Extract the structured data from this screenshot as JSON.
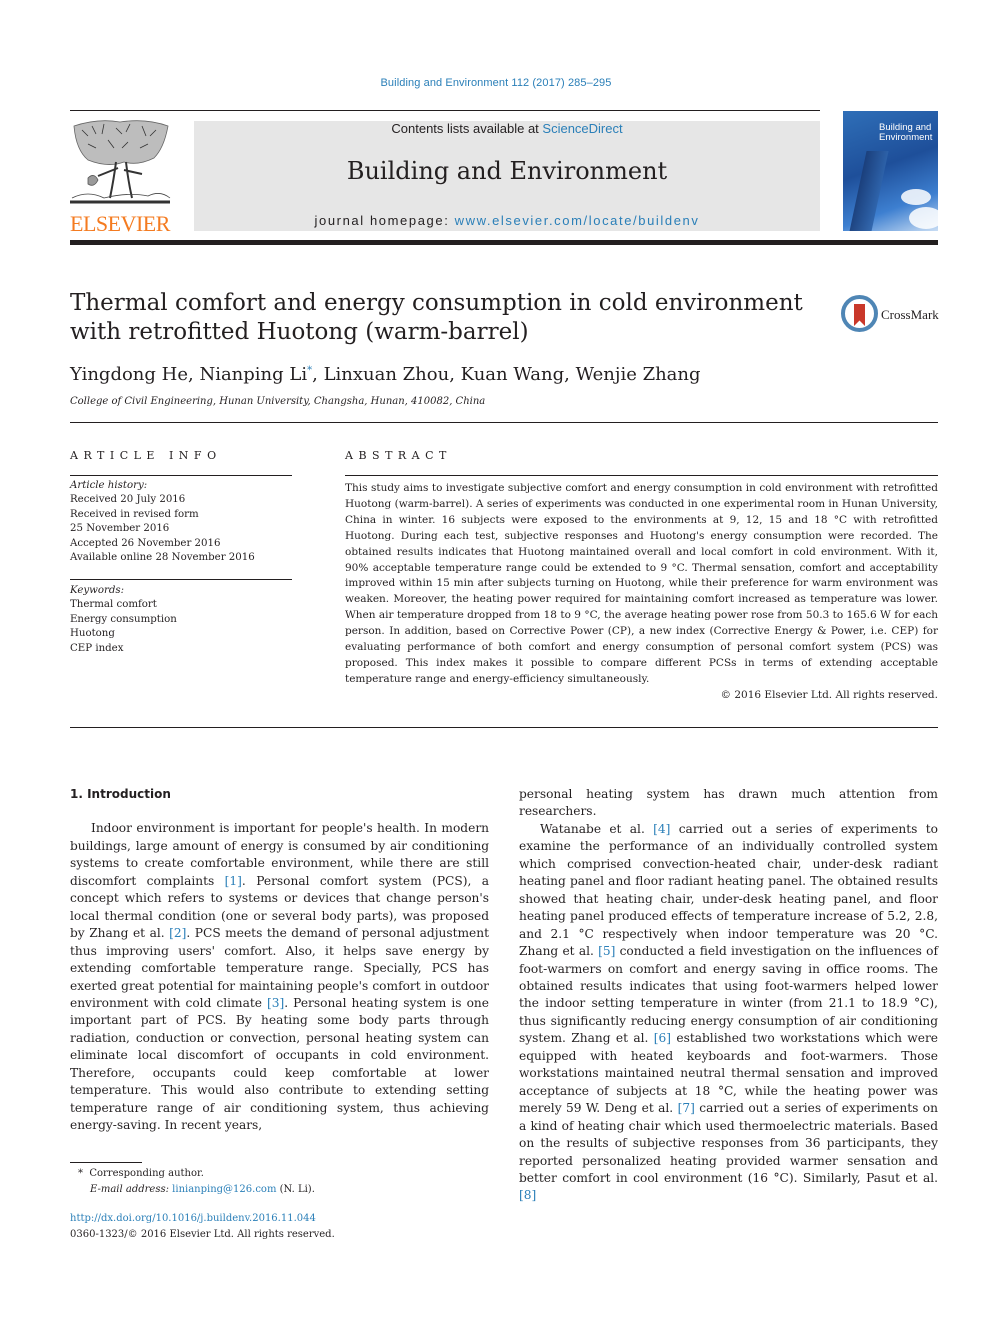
{
  "header": {
    "journal_ref": "Building and Environment 112 (2017) 285–295",
    "contents_prefix": "Contents lists available at ",
    "contents_link": "ScienceDirect",
    "journal_name": "Building and Environment",
    "homepage_prefix": "journal homepage: ",
    "homepage_link": "www.elsevier.com/locate/buildenv",
    "publisher_logo_text": "ELSEVIER",
    "cover_title_line1": "Building and",
    "cover_title_line2": "Environment",
    "brand_color": "#f47b20",
    "link_color": "#2a7fb8"
  },
  "article": {
    "title": "Thermal comfort and energy consumption in cold environment with retrofitted Huotong (warm-barrel)",
    "crossmark_label": "CrossMark",
    "authors": [
      {
        "name": "Yingdong He",
        "sep": ", "
      },
      {
        "name": "Nianping Li",
        "mark": "*",
        "sep": ", "
      },
      {
        "name": "Linxuan Zhou",
        "sep": ", "
      },
      {
        "name": "Kuan Wang",
        "sep": ", "
      },
      {
        "name": "Wenjie Zhang",
        "sep": ""
      }
    ],
    "affiliation": "College of Civil Engineering, Hunan University, Changsha, Hunan, 410082, China"
  },
  "article_info": {
    "heading": "ARTICLE INFO",
    "history_label": "Article history:",
    "history": [
      "Received 20 July 2016",
      "Received in revised form",
      "25 November 2016",
      "Accepted 26 November 2016",
      "Available online 28 November 2016"
    ],
    "keywords_label": "Keywords:",
    "keywords": [
      "Thermal comfort",
      "Energy consumption",
      "Huotong",
      "CEP index"
    ]
  },
  "abstract": {
    "heading": "ABSTRACT",
    "text": "This study aims to investigate subjective comfort and energy consumption in cold environment with retrofitted Huotong (warm-barrel). A series of experiments was conducted in one experimental room in Hunan University, China in winter. 16 subjects were exposed to the environments at 9, 12, 15 and 18 °C with retrofitted Huotong. During each test, subjective responses and Huotong's energy consumption were recorded. The obtained results indicates that Huotong maintained overall and local comfort in cold environment. With it, 90% acceptable temperature range could be extended to 9 °C. Thermal sensation, comfort and acceptability improved within 15 min after subjects turning on Huotong, while their preference for warm environment was weaken. Moreover, the heating power required for maintaining comfort increased as temperature was lower. When air temperature dropped from 18 to 9 °C, the average heating power rose from 50.3 to 165.6 W for each person. In addition, based on Corrective Power (CP), a new index (Corrective Energy & Power, i.e. CEP) for evaluating performance of both comfort and energy consumption of personal comfort system (PCS) was proposed. This index makes it possible to compare different PCSs in terms of extending acceptable temperature range and energy-efficiency simultaneously.",
    "copyright": "© 2016 Elsevier Ltd. All rights reserved."
  },
  "body": {
    "section_heading": "1.  Introduction",
    "left_segments": [
      {
        "t": "Indoor environment is important for people's health. In modern buildings, large amount of energy is consumed by air conditioning systems to create comfortable environment, while there are still discomfort complaints "
      },
      {
        "cite": "[1]"
      },
      {
        "t": ". Personal comfort system (PCS), a concept which refers to systems or devices that change person's local thermal condition (one or several body parts), was proposed by Zhang et al. "
      },
      {
        "cite": "[2]"
      },
      {
        "t": ". PCS meets the demand of personal adjustment thus improving users' comfort. Also, it helps save energy by extending comfortable temperature range. Specially, PCS has exerted great potential for maintaining people's comfort in outdoor environment with cold climate "
      },
      {
        "cite": "[3]"
      },
      {
        "t": ". Personal heating system is one important part of PCS. By heating some body parts through radiation, conduction or convection, personal heating system can eliminate local discomfort of occupants in cold environment. Therefore, occupants could keep comfortable at lower temperature. This would also contribute to extending setting temperature range of air conditioning system, thus achieving energy-saving. In recent years,"
      }
    ],
    "right_first": "personal heating system has drawn much attention from researchers.",
    "right_segments": [
      {
        "t": "Watanabe et al. "
      },
      {
        "cite": "[4]"
      },
      {
        "t": " carried out a series of experiments to examine the performance of an individually controlled system which comprised convection-heated chair, under-desk radiant heating panel and floor radiant heating panel. The obtained results showed that heating chair, under-desk heating panel, and floor heating panel produced effects of temperature increase of 5.2, 2.8, and 2.1 °C respectively when indoor temperature was 20 °C. Zhang et al. "
      },
      {
        "cite": "[5]"
      },
      {
        "t": " conducted a field investigation on the influences of foot-warmers on comfort and energy saving in office rooms. The obtained results indicates that using foot-warmers helped lower the indoor setting temperature in winter (from 21.1 to 18.9 °C), thus significantly reducing energy consumption of air conditioning system. Zhang et al. "
      },
      {
        "cite": "[6]"
      },
      {
        "t": " established two workstations which were equipped with heated keyboards and foot-warmers. Those workstations maintained neutral thermal sensation and improved acceptance of subjects at 18 °C, while the heating power was merely 59 W. Deng et al. "
      },
      {
        "cite": "[7]"
      },
      {
        "t": " carried out a series of experiments on a kind of heating chair which used thermoelectric materials. Based on the results of subjective responses from 36 participants, they reported personalized heating provided warmer sensation and better comfort in cool environment (16 °C). Similarly, Pasut et al. "
      },
      {
        "cite": "[8]"
      }
    ]
  },
  "footnotes": {
    "mark": "*",
    "corresponding": "Corresponding author.",
    "email_label": "E-mail address:",
    "email": "linianping@126.com",
    "email_suffix": " (N. Li).",
    "doi": "http://dx.doi.org/10.1016/j.buildenv.2016.11.044",
    "issn_line": "0360-1323/© 2016 Elsevier Ltd. All rights reserved."
  }
}
